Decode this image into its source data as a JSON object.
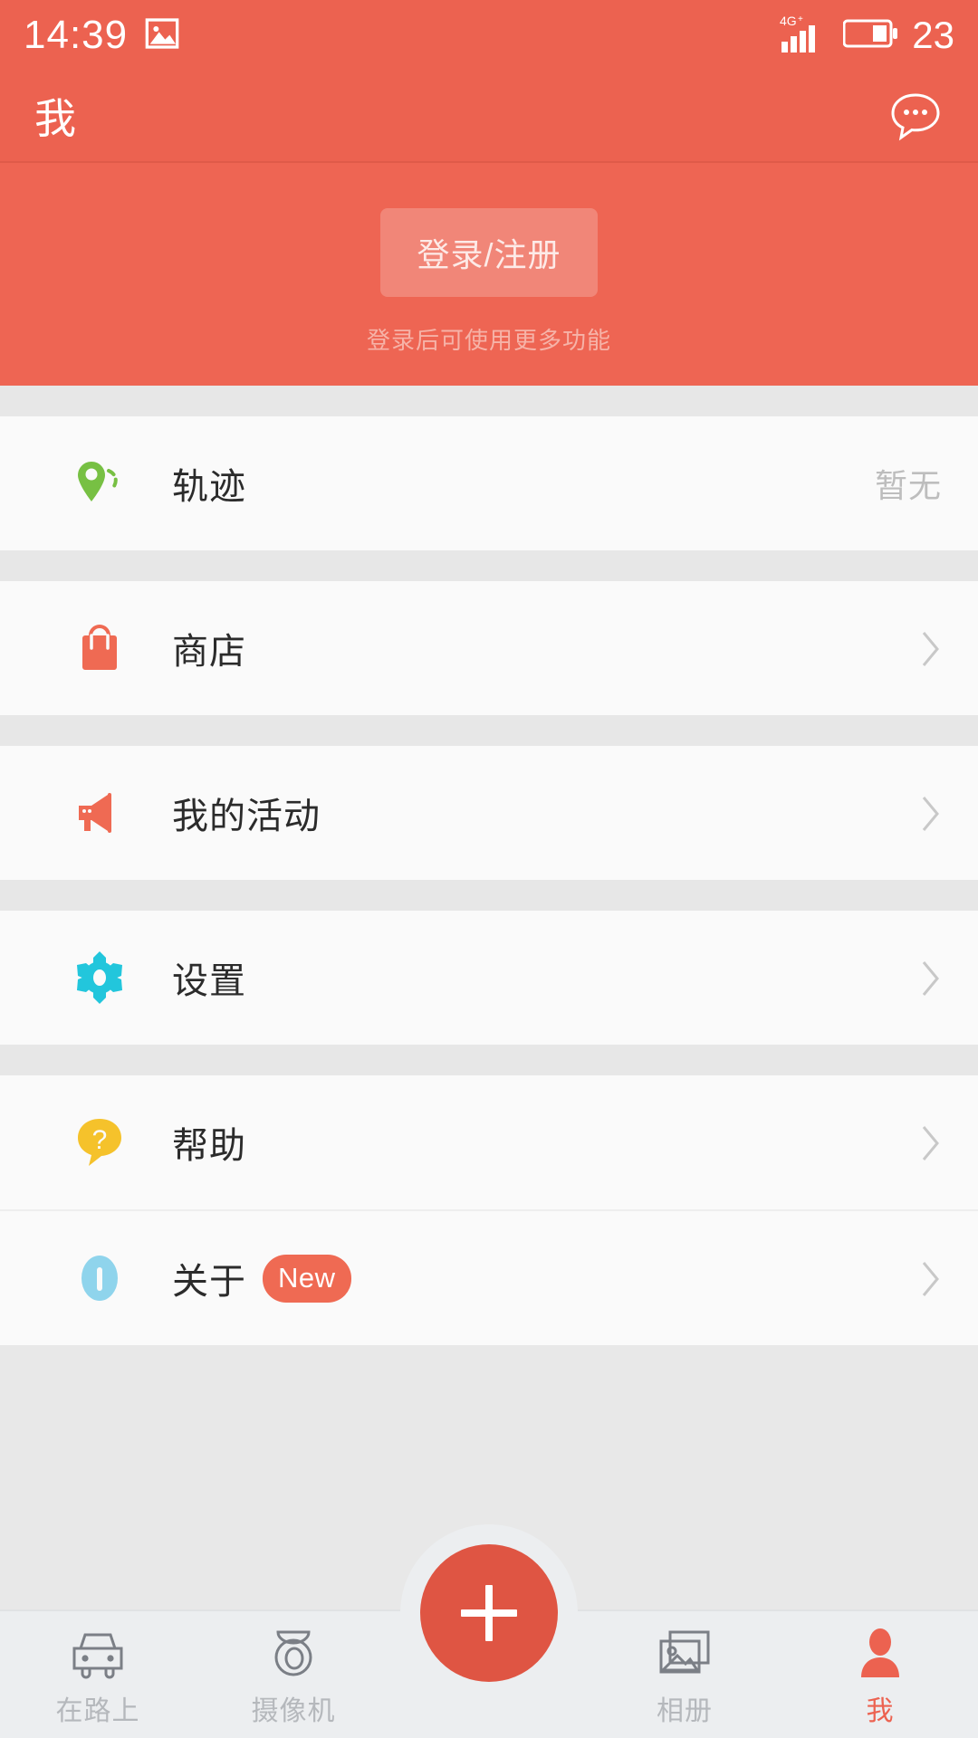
{
  "status_bar": {
    "time": "14:39",
    "gallery_icon": "image-icon",
    "network_label": "4G+",
    "signal_icon": "signal-bars-icon",
    "battery_icon": "battery-icon",
    "battery_level": "23"
  },
  "app_bar": {
    "title": "我",
    "message_icon": "chat-bubble-icon"
  },
  "hero": {
    "login_label": "登录/注册",
    "hint": "登录后可使用更多功能",
    "background_color": "#ee6553"
  },
  "menu": {
    "items": [
      {
        "label": "轨迹",
        "icon": "location-pin-trail-icon",
        "icon_color": "#77c043",
        "value": "暂无",
        "has_chevron": false,
        "badge": ""
      },
      {
        "label": "商店",
        "icon": "shopping-bag-icon",
        "icon_color": "#ef6a53",
        "value": "",
        "has_chevron": true,
        "badge": ""
      },
      {
        "label": "我的活动",
        "icon": "megaphone-icon",
        "icon_color": "#ef6a53",
        "value": "",
        "has_chevron": true,
        "badge": ""
      },
      {
        "label": "设置",
        "icon": "gear-icon",
        "icon_color": "#22c6dc",
        "value": "",
        "has_chevron": true,
        "badge": ""
      },
      {
        "label": "帮助",
        "icon": "question-bubble-icon",
        "icon_color": "#f5c22b",
        "value": "",
        "has_chevron": true,
        "badge": ""
      },
      {
        "label": "关于",
        "icon": "info-icon",
        "icon_color": "#8fd4ec",
        "value": "",
        "has_chevron": true,
        "badge": "New"
      }
    ]
  },
  "tabbar": {
    "items": [
      {
        "label": "在路上",
        "icon": "car-icon",
        "active": false
      },
      {
        "label": "摄像机",
        "icon": "dashcam-icon",
        "active": false
      },
      {
        "label": "相册",
        "icon": "photo-album-icon",
        "active": false
      },
      {
        "label": "我",
        "icon": "person-icon",
        "active": true
      }
    ],
    "fab_icon": "plus-icon",
    "active_color": "#ec6250",
    "inactive_color": "#b5b8bc"
  }
}
